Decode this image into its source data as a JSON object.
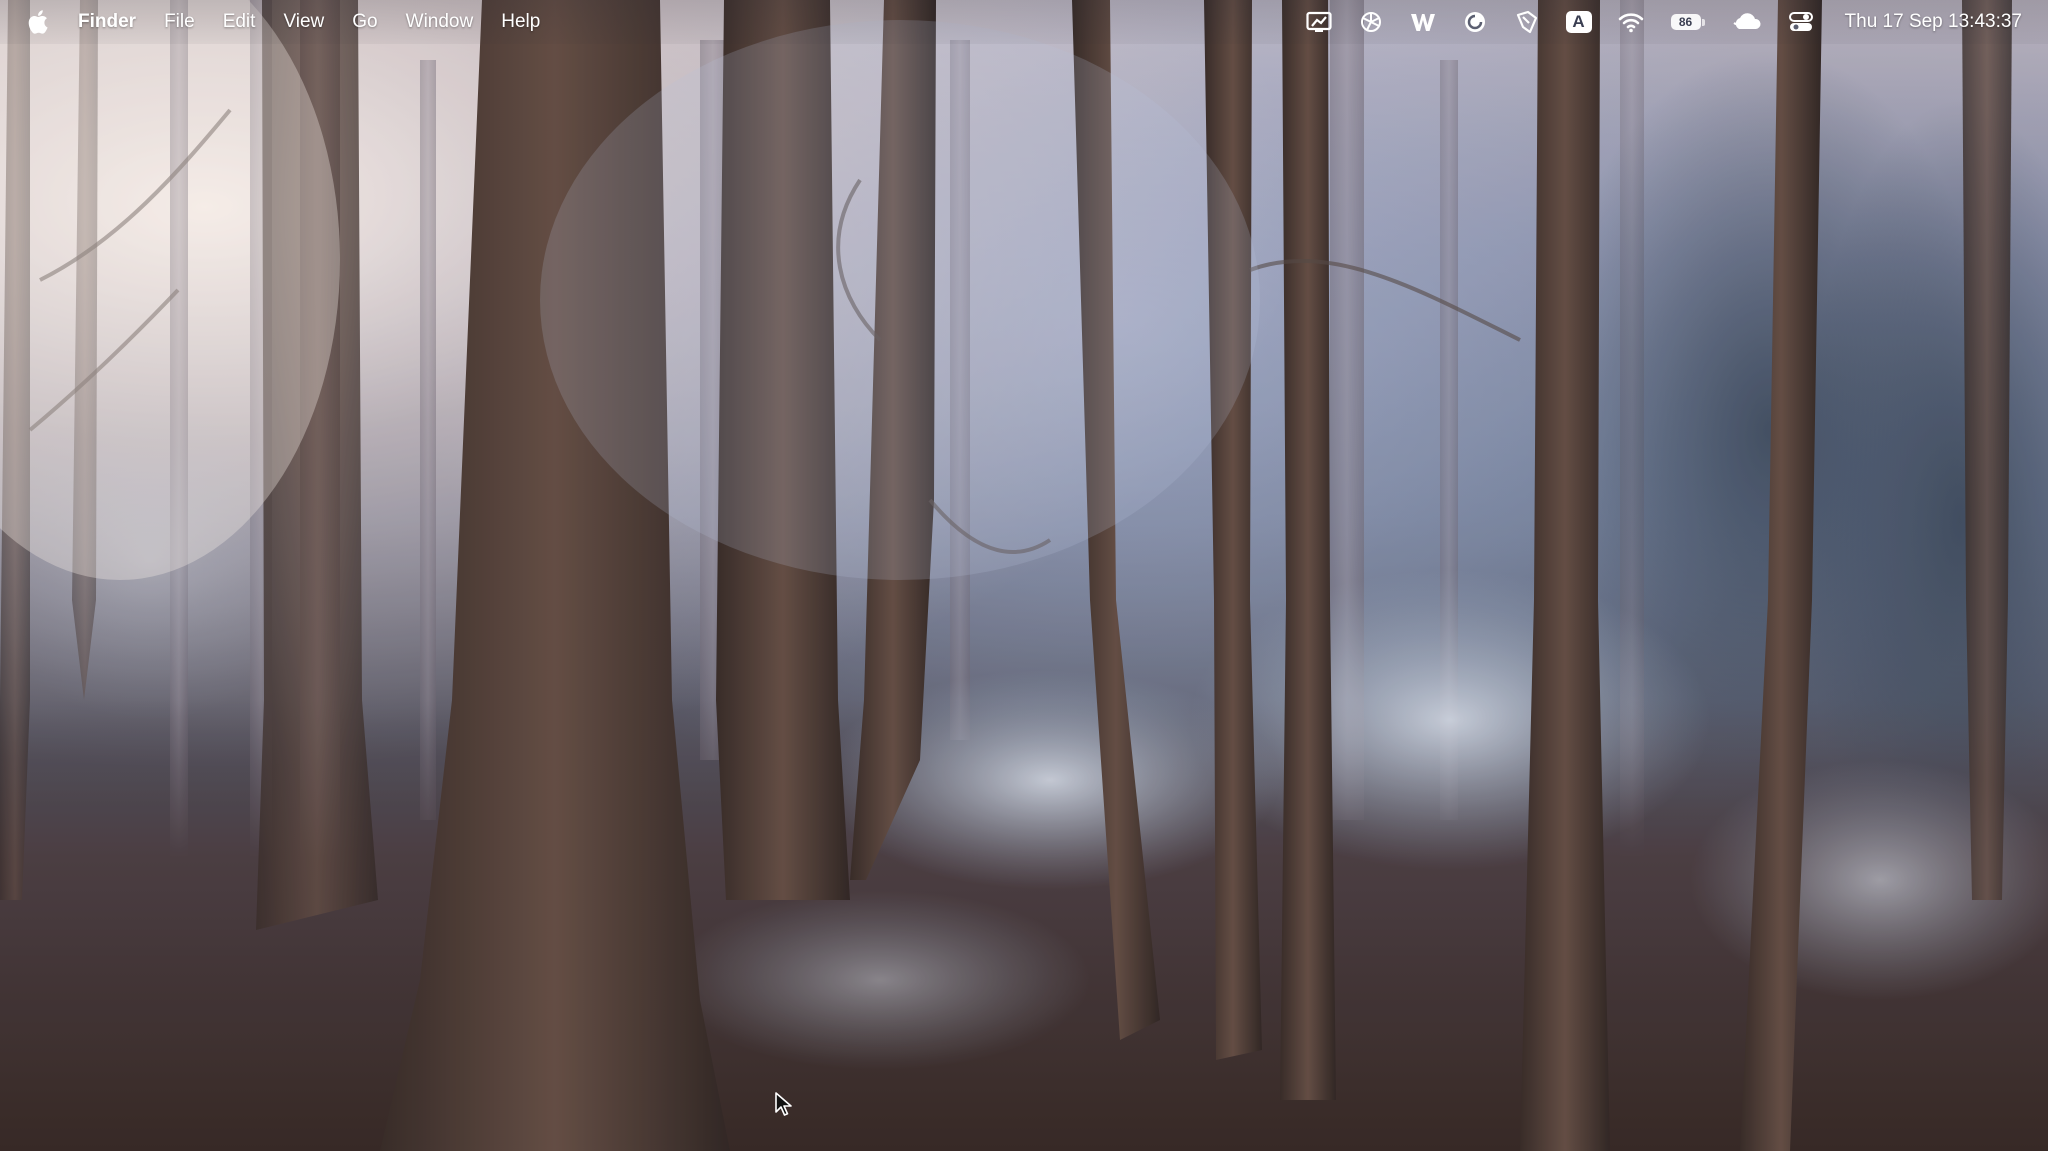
{
  "menubar": {
    "apple_icon": "apple-logo-icon",
    "app_name": "Finder",
    "menus": [
      "File",
      "Edit",
      "View",
      "Go",
      "Window",
      "Help"
    ]
  },
  "status": {
    "icons": [
      "screen-mirroring-icon",
      "chatgpt-icon",
      "word-w-icon",
      "circular-app-icon",
      "shield-hand-icon"
    ],
    "input_source": "A",
    "wifi_icon": "wifi-icon",
    "battery_level": "86",
    "weather_icon": "cloud-moon-icon",
    "control_center_icon": "control-center-icon",
    "datetime": "Thu 17 Sep  13:43:37"
  },
  "wallpaper": {
    "subject_icon": "foggy-forest-wallpaper",
    "colors": {
      "fog": "#e9ddd6",
      "blue_haze": "#8fa0c0",
      "trunk": "#3a2a22",
      "ground": "#3b2a22",
      "frost": "#c9d3e2"
    }
  },
  "cursor": {
    "icon": "mouse-pointer-icon"
  }
}
